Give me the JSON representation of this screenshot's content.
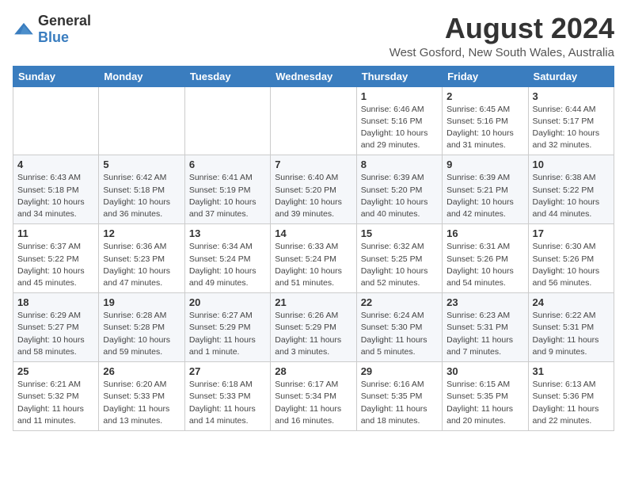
{
  "header": {
    "logo_general": "General",
    "logo_blue": "Blue",
    "month_year": "August 2024",
    "location": "West Gosford, New South Wales, Australia"
  },
  "weekdays": [
    "Sunday",
    "Monday",
    "Tuesday",
    "Wednesday",
    "Thursday",
    "Friday",
    "Saturday"
  ],
  "weeks": [
    [
      {
        "day": "",
        "sunrise": "",
        "sunset": "",
        "daylight": ""
      },
      {
        "day": "",
        "sunrise": "",
        "sunset": "",
        "daylight": ""
      },
      {
        "day": "",
        "sunrise": "",
        "sunset": "",
        "daylight": ""
      },
      {
        "day": "",
        "sunrise": "",
        "sunset": "",
        "daylight": ""
      },
      {
        "day": "1",
        "sunrise": "Sunrise: 6:46 AM",
        "sunset": "Sunset: 5:16 PM",
        "daylight": "Daylight: 10 hours and 29 minutes."
      },
      {
        "day": "2",
        "sunrise": "Sunrise: 6:45 AM",
        "sunset": "Sunset: 5:16 PM",
        "daylight": "Daylight: 10 hours and 31 minutes."
      },
      {
        "day": "3",
        "sunrise": "Sunrise: 6:44 AM",
        "sunset": "Sunset: 5:17 PM",
        "daylight": "Daylight: 10 hours and 32 minutes."
      }
    ],
    [
      {
        "day": "4",
        "sunrise": "Sunrise: 6:43 AM",
        "sunset": "Sunset: 5:18 PM",
        "daylight": "Daylight: 10 hours and 34 minutes."
      },
      {
        "day": "5",
        "sunrise": "Sunrise: 6:42 AM",
        "sunset": "Sunset: 5:18 PM",
        "daylight": "Daylight: 10 hours and 36 minutes."
      },
      {
        "day": "6",
        "sunrise": "Sunrise: 6:41 AM",
        "sunset": "Sunset: 5:19 PM",
        "daylight": "Daylight: 10 hours and 37 minutes."
      },
      {
        "day": "7",
        "sunrise": "Sunrise: 6:40 AM",
        "sunset": "Sunset: 5:20 PM",
        "daylight": "Daylight: 10 hours and 39 minutes."
      },
      {
        "day": "8",
        "sunrise": "Sunrise: 6:39 AM",
        "sunset": "Sunset: 5:20 PM",
        "daylight": "Daylight: 10 hours and 40 minutes."
      },
      {
        "day": "9",
        "sunrise": "Sunrise: 6:39 AM",
        "sunset": "Sunset: 5:21 PM",
        "daylight": "Daylight: 10 hours and 42 minutes."
      },
      {
        "day": "10",
        "sunrise": "Sunrise: 6:38 AM",
        "sunset": "Sunset: 5:22 PM",
        "daylight": "Daylight: 10 hours and 44 minutes."
      }
    ],
    [
      {
        "day": "11",
        "sunrise": "Sunrise: 6:37 AM",
        "sunset": "Sunset: 5:22 PM",
        "daylight": "Daylight: 10 hours and 45 minutes."
      },
      {
        "day": "12",
        "sunrise": "Sunrise: 6:36 AM",
        "sunset": "Sunset: 5:23 PM",
        "daylight": "Daylight: 10 hours and 47 minutes."
      },
      {
        "day": "13",
        "sunrise": "Sunrise: 6:34 AM",
        "sunset": "Sunset: 5:24 PM",
        "daylight": "Daylight: 10 hours and 49 minutes."
      },
      {
        "day": "14",
        "sunrise": "Sunrise: 6:33 AM",
        "sunset": "Sunset: 5:24 PM",
        "daylight": "Daylight: 10 hours and 51 minutes."
      },
      {
        "day": "15",
        "sunrise": "Sunrise: 6:32 AM",
        "sunset": "Sunset: 5:25 PM",
        "daylight": "Daylight: 10 hours and 52 minutes."
      },
      {
        "day": "16",
        "sunrise": "Sunrise: 6:31 AM",
        "sunset": "Sunset: 5:26 PM",
        "daylight": "Daylight: 10 hours and 54 minutes."
      },
      {
        "day": "17",
        "sunrise": "Sunrise: 6:30 AM",
        "sunset": "Sunset: 5:26 PM",
        "daylight": "Daylight: 10 hours and 56 minutes."
      }
    ],
    [
      {
        "day": "18",
        "sunrise": "Sunrise: 6:29 AM",
        "sunset": "Sunset: 5:27 PM",
        "daylight": "Daylight: 10 hours and 58 minutes."
      },
      {
        "day": "19",
        "sunrise": "Sunrise: 6:28 AM",
        "sunset": "Sunset: 5:28 PM",
        "daylight": "Daylight: 10 hours and 59 minutes."
      },
      {
        "day": "20",
        "sunrise": "Sunrise: 6:27 AM",
        "sunset": "Sunset: 5:29 PM",
        "daylight": "Daylight: 11 hours and 1 minute."
      },
      {
        "day": "21",
        "sunrise": "Sunrise: 6:26 AM",
        "sunset": "Sunset: 5:29 PM",
        "daylight": "Daylight: 11 hours and 3 minutes."
      },
      {
        "day": "22",
        "sunrise": "Sunrise: 6:24 AM",
        "sunset": "Sunset: 5:30 PM",
        "daylight": "Daylight: 11 hours and 5 minutes."
      },
      {
        "day": "23",
        "sunrise": "Sunrise: 6:23 AM",
        "sunset": "Sunset: 5:31 PM",
        "daylight": "Daylight: 11 hours and 7 minutes."
      },
      {
        "day": "24",
        "sunrise": "Sunrise: 6:22 AM",
        "sunset": "Sunset: 5:31 PM",
        "daylight": "Daylight: 11 hours and 9 minutes."
      }
    ],
    [
      {
        "day": "25",
        "sunrise": "Sunrise: 6:21 AM",
        "sunset": "Sunset: 5:32 PM",
        "daylight": "Daylight: 11 hours and 11 minutes."
      },
      {
        "day": "26",
        "sunrise": "Sunrise: 6:20 AM",
        "sunset": "Sunset: 5:33 PM",
        "daylight": "Daylight: 11 hours and 13 minutes."
      },
      {
        "day": "27",
        "sunrise": "Sunrise: 6:18 AM",
        "sunset": "Sunset: 5:33 PM",
        "daylight": "Daylight: 11 hours and 14 minutes."
      },
      {
        "day": "28",
        "sunrise": "Sunrise: 6:17 AM",
        "sunset": "Sunset: 5:34 PM",
        "daylight": "Daylight: 11 hours and 16 minutes."
      },
      {
        "day": "29",
        "sunrise": "Sunrise: 6:16 AM",
        "sunset": "Sunset: 5:35 PM",
        "daylight": "Daylight: 11 hours and 18 minutes."
      },
      {
        "day": "30",
        "sunrise": "Sunrise: 6:15 AM",
        "sunset": "Sunset: 5:35 PM",
        "daylight": "Daylight: 11 hours and 20 minutes."
      },
      {
        "day": "31",
        "sunrise": "Sunrise: 6:13 AM",
        "sunset": "Sunset: 5:36 PM",
        "daylight": "Daylight: 11 hours and 22 minutes."
      }
    ]
  ]
}
